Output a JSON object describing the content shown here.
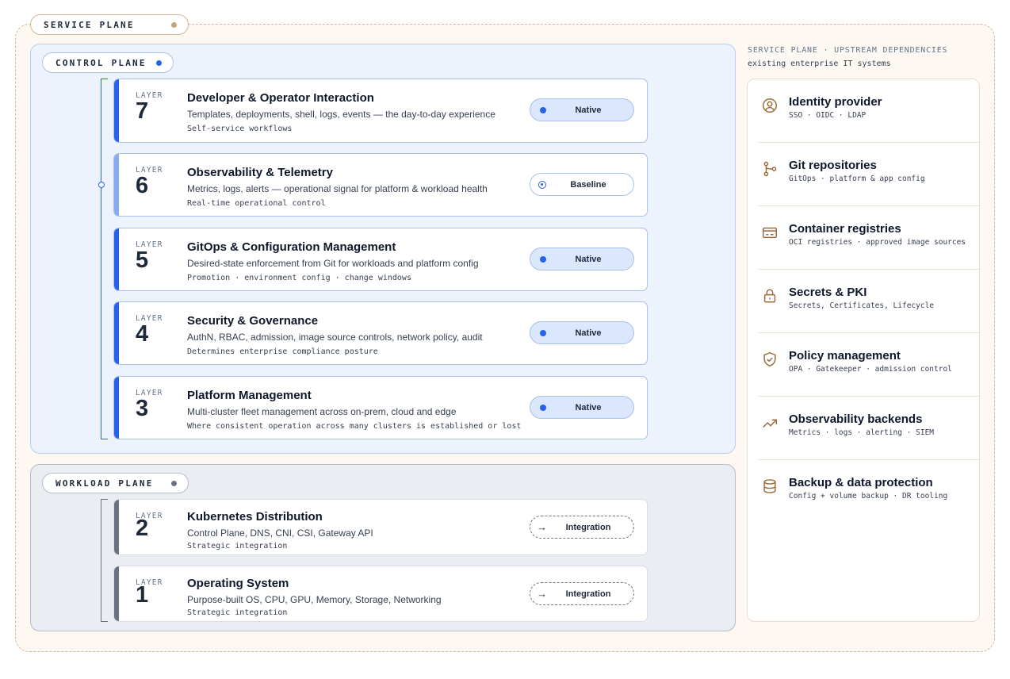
{
  "service_plane": {
    "label": "SERVICE PLANE"
  },
  "control_plane": {
    "label": "CONTROL PLANE",
    "layers": [
      {
        "label": "LAYER",
        "number": "7",
        "title": "Developer & Operator Interaction",
        "description": "Templates, deployments, shell, logs, events — the day-to-day experience",
        "note": "Self-service workflows",
        "status": "Native"
      },
      {
        "label": "LAYER",
        "number": "6",
        "title": "Observability & Telemetry",
        "description": "Metrics, logs, alerts — operational signal for platform & workload health",
        "note": "Real-time operational control",
        "status": "Baseline"
      },
      {
        "label": "LAYER",
        "number": "5",
        "title": "GitOps & Configuration Management",
        "description": "Desired-state enforcement from Git for workloads and platform config",
        "note": "Promotion · environment config · change windows",
        "status": "Native"
      },
      {
        "label": "LAYER",
        "number": "4",
        "title": "Security & Governance",
        "description": "AuthN, RBAC, admission, image source controls, network policy, audit",
        "note": "Determines enterprise compliance posture",
        "status": "Native"
      },
      {
        "label": "LAYER",
        "number": "3",
        "title": "Platform Management",
        "description": "Multi-cluster fleet management across on-prem, cloud and edge",
        "note": "Where consistent operation across many clusters is established or lost",
        "status": "Native"
      }
    ]
  },
  "workload_plane": {
    "label": "WORKLOAD PLANE",
    "layers": [
      {
        "label": "LAYER",
        "number": "2",
        "title": "Kubernetes Distribution",
        "description": "Control Plane, DNS, CNI, CSI, Gateway API",
        "note": "Strategic integration",
        "status": "Integration"
      },
      {
        "label": "LAYER",
        "number": "1",
        "title": "Operating System",
        "description": "Purpose-built OS, CPU, GPU, Memory, Storage, Networking",
        "note": "Strategic integration",
        "status": "Integration"
      }
    ]
  },
  "dependencies": {
    "heading": "SERVICE PLANE · UPSTREAM DEPENDENCIES",
    "subheading": "existing enterprise IT systems",
    "items": [
      {
        "icon": "identity-icon",
        "name": "Identity provider",
        "details": "SSO · OIDC · LDAP"
      },
      {
        "icon": "git-icon",
        "name": "Git repositories",
        "details": "GitOps · platform & app config"
      },
      {
        "icon": "registry-icon",
        "name": "Container registries",
        "details": "OCI registries · approved image sources"
      },
      {
        "icon": "lock-icon",
        "name": "Secrets & PKI",
        "details": "Secrets, Certificates, Lifecycle"
      },
      {
        "icon": "shield-check-icon",
        "name": "Policy management",
        "details": "OPA · Gatekeeper · admission control"
      },
      {
        "icon": "trend-up-icon",
        "name": "Observability backends",
        "details": "Metrics · logs · alerting · SIEM"
      },
      {
        "icon": "database-icon",
        "name": "Backup & data protection",
        "details": "Config + volume backup · DR tooling"
      }
    ]
  },
  "colors": {
    "native_accent": "#2563eb",
    "workload_accent": "#6b7280",
    "service_accent": "#c9a57a"
  }
}
